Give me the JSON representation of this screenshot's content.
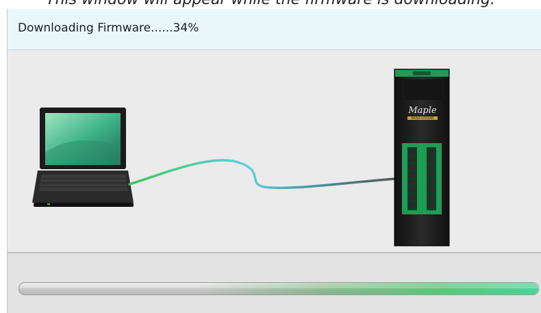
{
  "caption": "This window will appear while the firmware is downloading.",
  "window": {
    "title": "Downloading Firmware......34%"
  },
  "progress": {
    "percent": 34
  },
  "device": {
    "brand_logo": "Maple",
    "brand_subtext": "MAPLE SYSTEMS"
  },
  "colors": {
    "titlebar_bg": "#e9f7fb",
    "device_green": "#1f9c55",
    "cable_cyan": "#5fd0e0",
    "cable_green": "#3cc55a",
    "progress_green": "#4fd39a"
  },
  "icons": {
    "laptop": "laptop-icon",
    "device": "plc-controller-icon",
    "cable": "usb-cable-icon"
  }
}
